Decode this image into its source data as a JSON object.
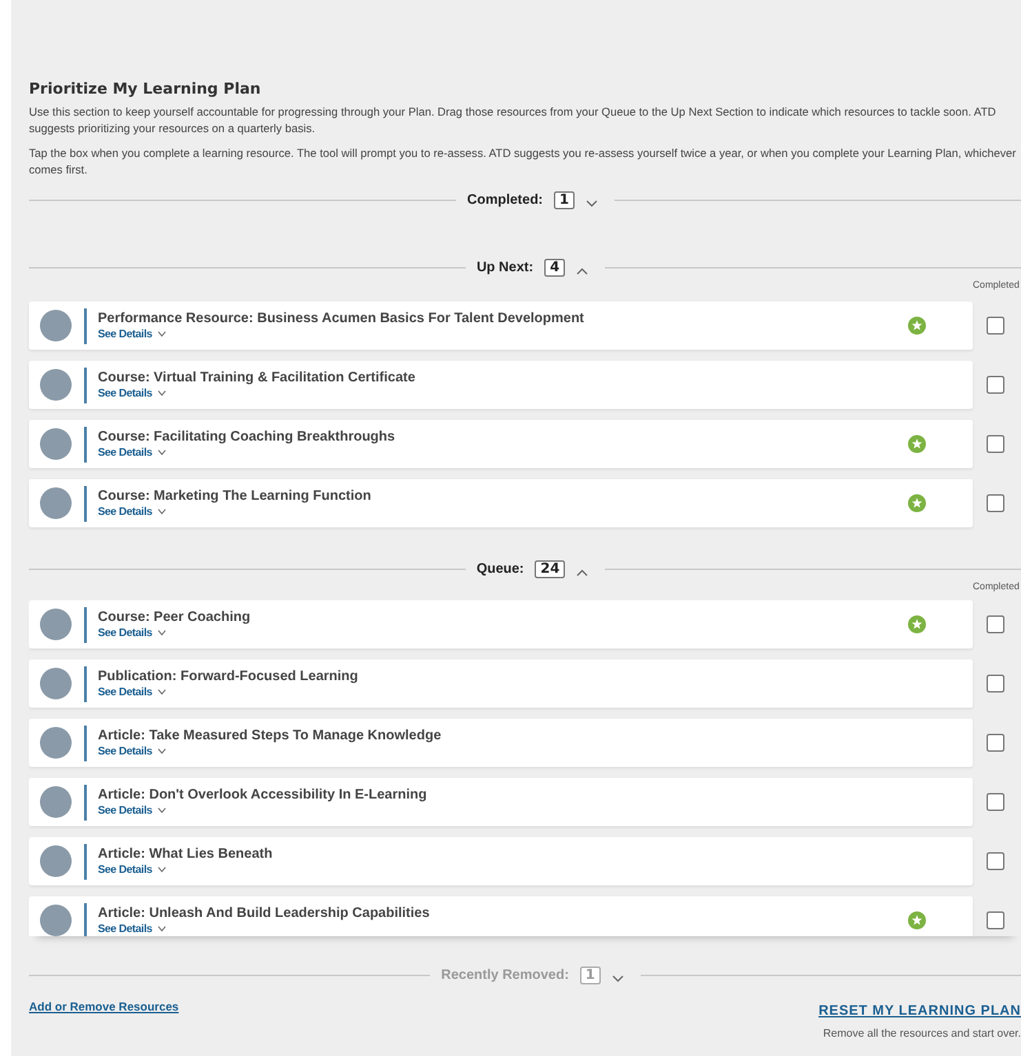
{
  "header": {
    "title": "Prioritize My Learning Plan",
    "paragraphs": [
      "Use this section to keep yourself accountable for progressing through your Plan. Drag those resources from your Queue to the Up Next Section to indicate which resources to tackle soon. ATD suggests prioritizing your resources on a quarterly basis.",
      "Tap the box when you complete a learning resource. The tool will prompt you to re-assess. ATD suggests you re-assess yourself twice a year, or when you complete your Learning Plan, whichever comes first."
    ]
  },
  "sections": [
    {
      "label": "Completed:",
      "count": "1",
      "expanded": false,
      "disabled": false
    },
    {
      "label": "Up Next:",
      "count": "4",
      "expanded": true,
      "disabled": false,
      "column_header": "Completed",
      "items": [
        {
          "title": "Performance Resource: Business Acumen Basics For Talent Development",
          "details": "See Details",
          "featured": true,
          "completed": false
        },
        {
          "title": "Course: Virtual Training & Facilitation Certificate",
          "details": "See Details",
          "featured": false,
          "completed": false
        },
        {
          "title": "Course: Facilitating Coaching Breakthroughs",
          "details": "See Details",
          "featured": true,
          "completed": false
        },
        {
          "title": "Course: Marketing The Learning Function",
          "details": "See Details",
          "featured": true,
          "completed": false
        }
      ]
    },
    {
      "label": "Queue:",
      "count": "24",
      "expanded": true,
      "disabled": false,
      "column_header": "Completed",
      "items": [
        {
          "title": "Course: Peer Coaching",
          "details": "See Details",
          "featured": true,
          "completed": false
        },
        {
          "title": "Publication: Forward-Focused Learning",
          "details": "See Details",
          "featured": false,
          "completed": false
        },
        {
          "title": "Article: Take Measured Steps To Manage Knowledge",
          "details": "See Details",
          "featured": false,
          "completed": false
        },
        {
          "title": "Article: Don't Overlook Accessibility In E-Learning",
          "details": "See Details",
          "featured": false,
          "completed": false
        },
        {
          "title": "Article: What Lies Beneath",
          "details": "See Details",
          "featured": false,
          "completed": false
        },
        {
          "title": "Article: Unleash And Build Leadership Capabilities",
          "details": "See Details",
          "featured": true,
          "completed": false
        }
      ]
    },
    {
      "label": "Recently Removed:",
      "count": "1",
      "expanded": false,
      "disabled": true
    }
  ],
  "footer": {
    "add_link": "Add or Remove Resources",
    "reset_link": "RESET MY LEARNING PLAN",
    "reset_note": "Remove all the resources and start over."
  }
}
